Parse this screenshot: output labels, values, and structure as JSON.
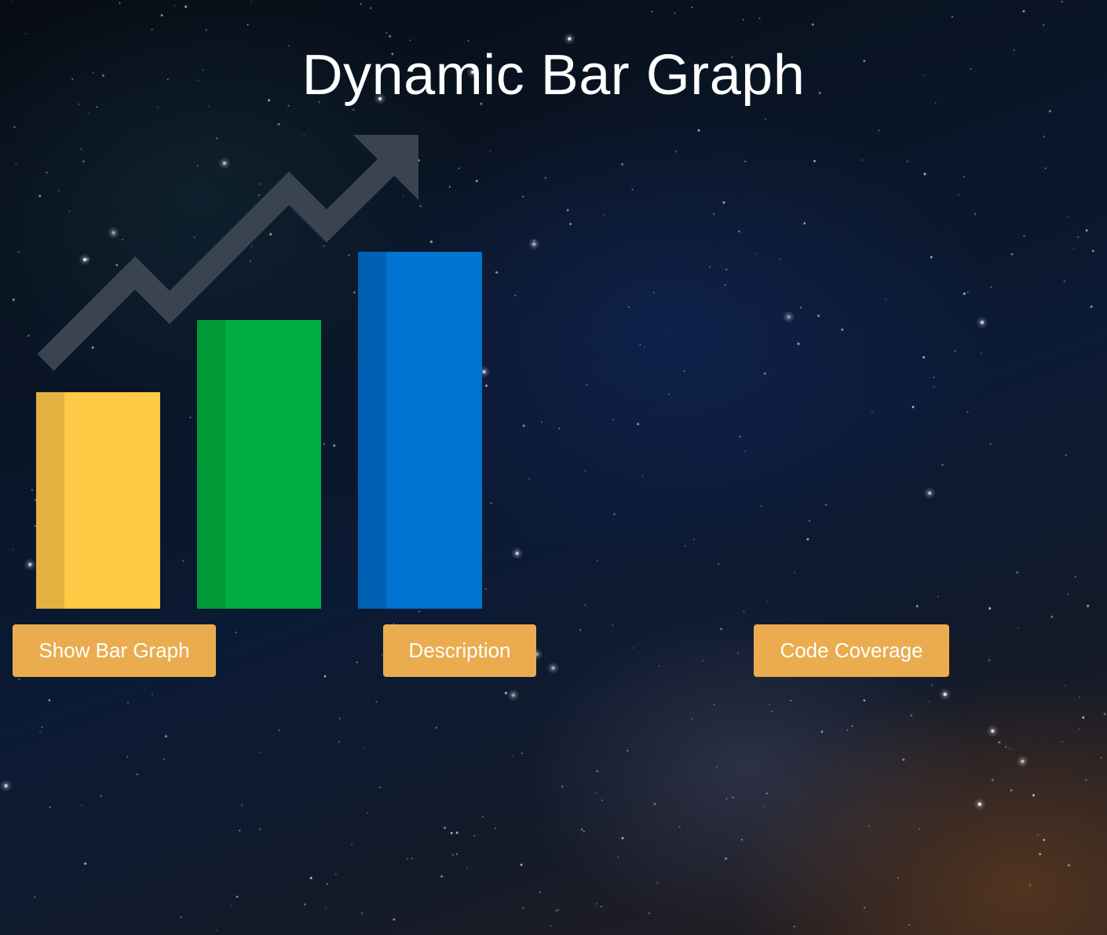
{
  "page": {
    "title": "Dynamic Bar Graph"
  },
  "illustration": {
    "icon": "trend-arrow-icon",
    "arrow_color": "#3a4450",
    "bars": [
      {
        "name": "bar-yellow",
        "level": 0.6,
        "color": "#ffc845",
        "shade": "#e4b240"
      },
      {
        "name": "bar-green",
        "level": 0.8,
        "color": "#00ad42",
        "shade": "#009a38"
      },
      {
        "name": "bar-blue",
        "level": 0.99,
        "color": "#0074d0",
        "shade": "#0060b3"
      }
    ]
  },
  "buttons": {
    "show_bar_graph": "Show Bar Graph",
    "description": "Description",
    "code_coverage": "Code Coverage"
  },
  "colors": {
    "button_bg": "#eaac4e",
    "button_text": "#ffffff",
    "title_text": "#ffffff"
  }
}
